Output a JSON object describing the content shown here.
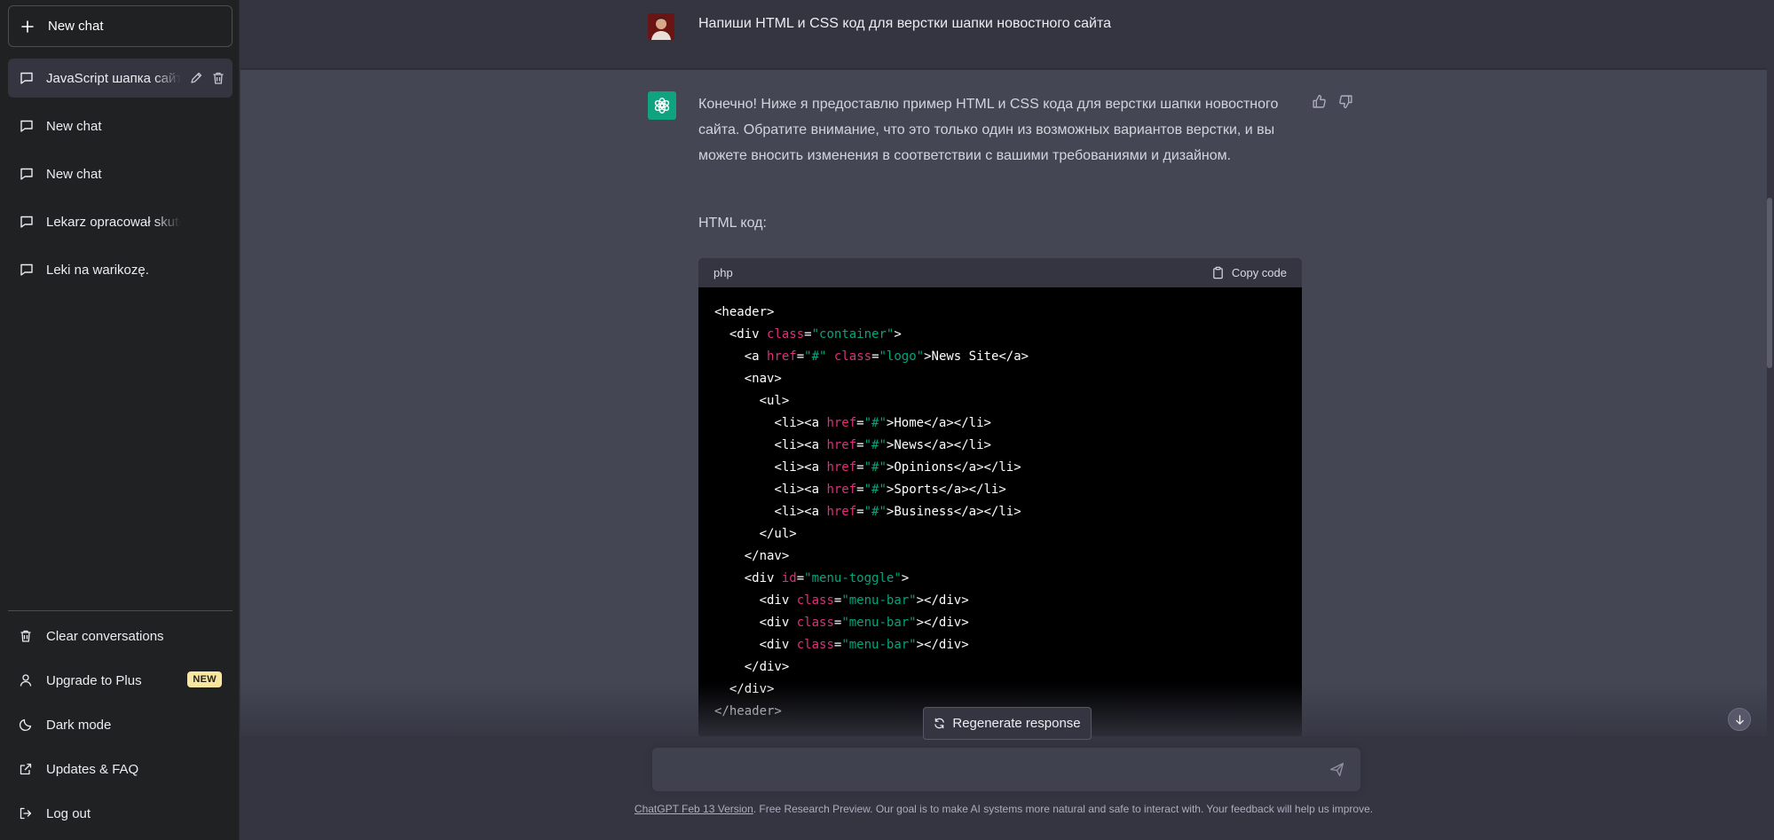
{
  "sidebar": {
    "new_chat": "New chat",
    "conversations": [
      {
        "label": "JavaScript шапка сайта"
      },
      {
        "label": "New chat"
      },
      {
        "label": "New chat"
      },
      {
        "label": "Lekarz opracował skuteczny"
      },
      {
        "label": "Leki na warikozę."
      }
    ],
    "menu": {
      "clear": "Clear conversations",
      "upgrade": "Upgrade to Plus",
      "upgrade_badge": "NEW",
      "dark_mode": "Dark mode",
      "updates": "Updates & FAQ",
      "logout": "Log out"
    }
  },
  "thread": {
    "user_message": "Напиши HTML и CSS код для верстки шапки новостного сайта",
    "assistant_intro": "Конечно! Ниже я предоставлю пример HTML и CSS кода для верстки шапки новостного сайта. Обратите внимание, что это только один из возможных вариантов верстки, и вы можете вносить изменения в соответствии с вашими требованиями и дизайном.",
    "html_label": "HTML код:",
    "code_lang": "php",
    "copy_label": "Copy code"
  },
  "regenerate_label": "Regenerate response",
  "footer": {
    "version_link": "ChatGPT Feb 13 Version",
    "text": ". Free Research Preview. Our goal is to make AI systems more natural and safe to interact with. Your feedback will help us improve."
  },
  "colors": {
    "sidebar_bg": "#202123",
    "main_bg": "#343541",
    "assistant_bg": "#444654",
    "accent": "#10a37f",
    "code_attr": "#df3079",
    "code_string": "#00a67d",
    "badge": "#fae69e"
  }
}
